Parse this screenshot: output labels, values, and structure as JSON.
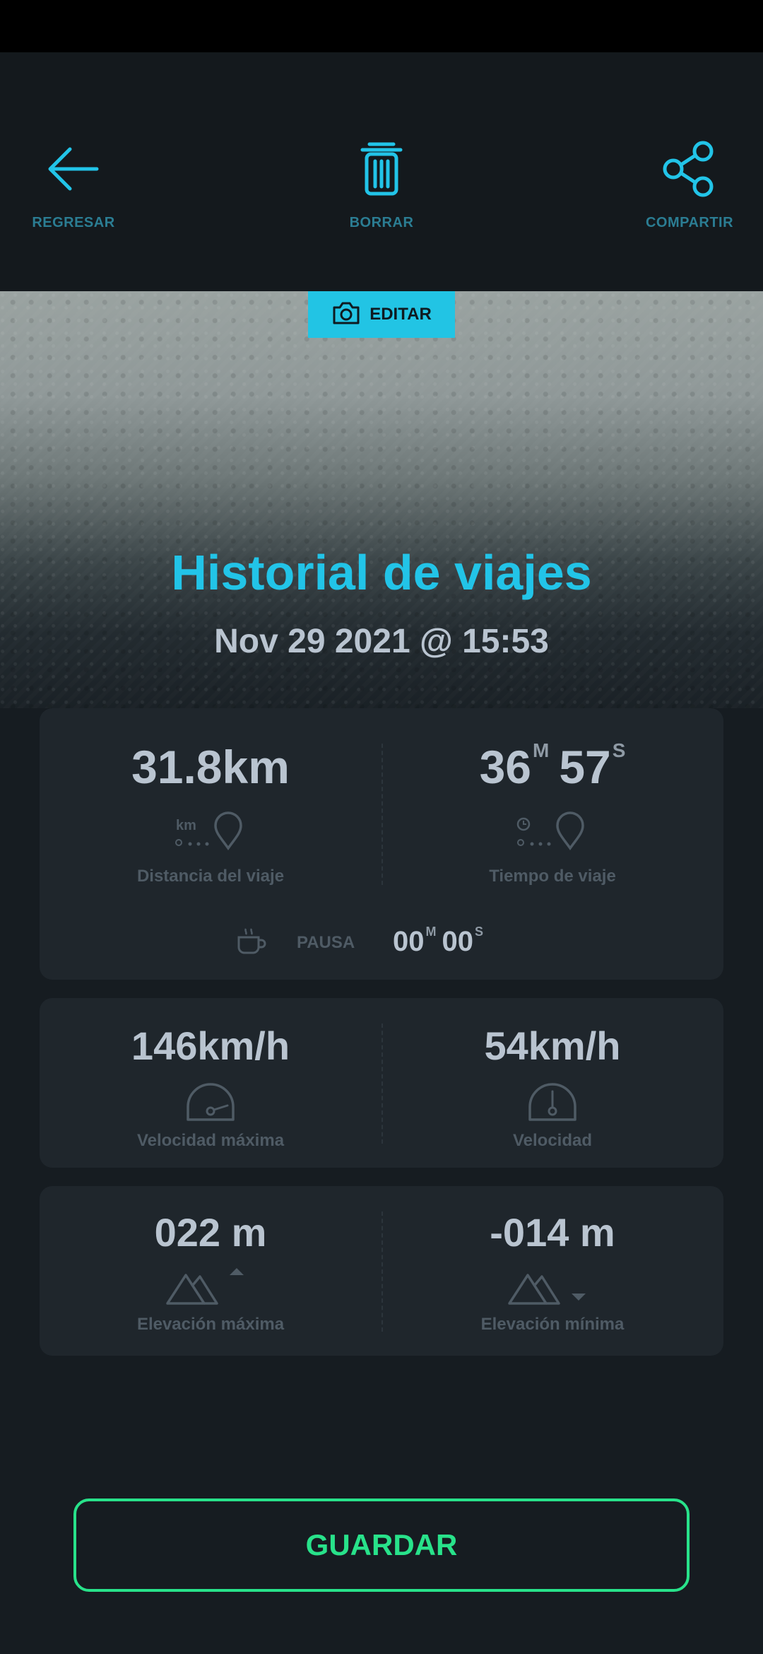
{
  "toolbar": {
    "back_label": "REGRESAR",
    "delete_label": "BORRAR",
    "share_label": "COMPARTIR"
  },
  "hero": {
    "edit_label": "EDITAR",
    "title": "Historial de viajes",
    "datetime": "Nov 29 2021 @ 15:53"
  },
  "trip": {
    "distance": "31.8km",
    "distance_caption": "Distancia del viaje",
    "distance_icon_unit": "km",
    "time_minutes": "36",
    "time_minutes_unit": "M",
    "time_seconds": "57",
    "time_seconds_unit": "S",
    "time_caption": "Tiempo de viaje",
    "pause_label": "PAUSA",
    "pause_minutes": "00",
    "pause_minutes_unit": "M",
    "pause_seconds": "00",
    "pause_seconds_unit": "S"
  },
  "speed": {
    "max_value": "146km/h",
    "max_caption": "Velocidad máxima",
    "avg_value": "54km/h",
    "avg_caption": "Velocidad"
  },
  "elevation": {
    "max_value": "022 m",
    "max_caption": "Elevación máxima",
    "min_value": "-014 m",
    "min_caption": "Elevación mínima"
  },
  "save_label": "GUARDAR",
  "colors": {
    "accent": "#22c4e8",
    "save": "#28e28a",
    "toolbar_label": "#2b7d93"
  }
}
